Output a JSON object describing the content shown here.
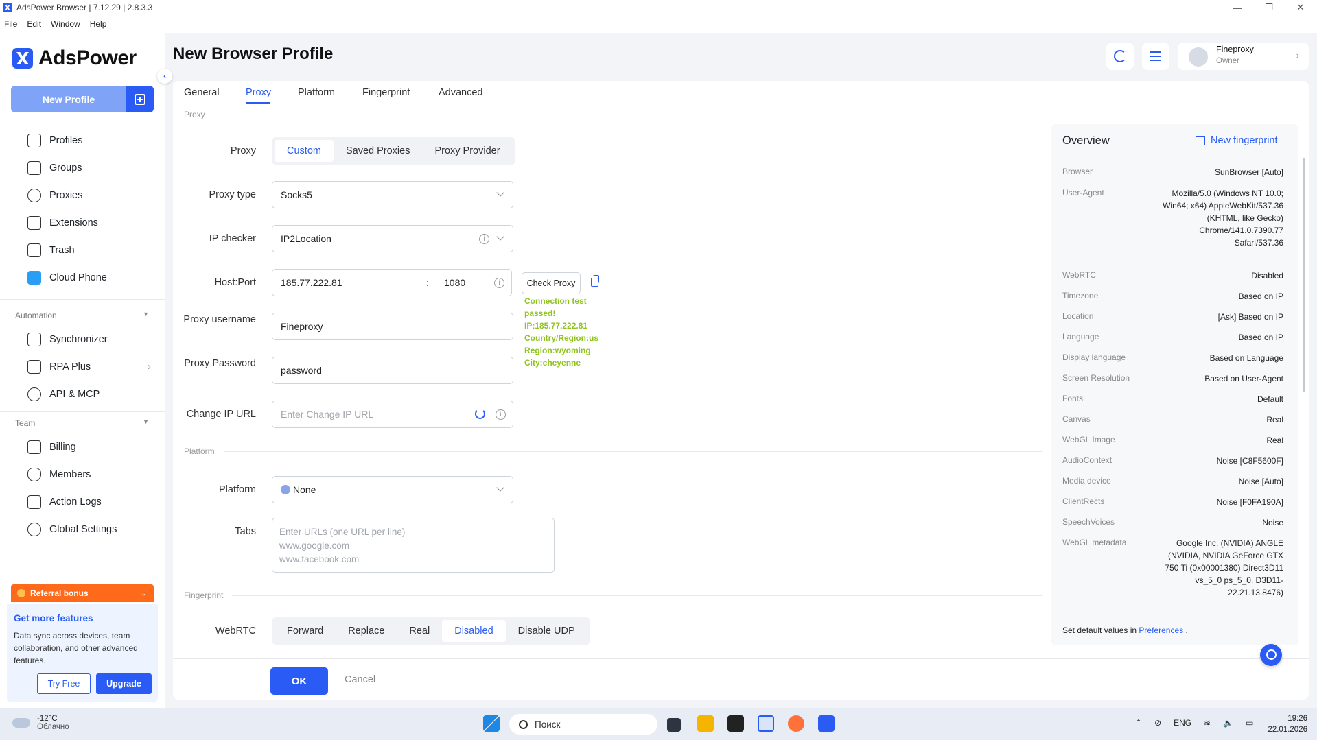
{
  "window": {
    "title": "AdsPower Browser | 7.12.29 | 2.8.3.3",
    "minimize": "—",
    "maximize": "❐",
    "close": "✕"
  },
  "menu": [
    "File",
    "Edit",
    "Window",
    "Help"
  ],
  "sidebar": {
    "brand": "AdsPower",
    "new_profile": "New Profile",
    "items": [
      "Profiles",
      "Groups",
      "Proxies",
      "Extensions",
      "Trash",
      "Cloud Phone"
    ],
    "automation_label": "Automation",
    "automation_items": [
      "Synchronizer",
      "RPA Plus",
      "API & MCP"
    ],
    "team_label": "Team",
    "team_items": [
      "Billing",
      "Members",
      "Action Logs",
      "Global Settings"
    ],
    "referral": "Referral bonus",
    "features_title": "Get more features",
    "features_desc": "Data sync across devices, team collaboration, and other advanced features.",
    "try_free": "Try Free",
    "upgrade": "Upgrade"
  },
  "header": {
    "title": "New Browser Profile",
    "user_name": "Fineproxy",
    "user_role": "Owner"
  },
  "tabs": [
    "General",
    "Proxy",
    "Platform",
    "Fingerprint",
    "Advanced"
  ],
  "proxy": {
    "section": "Proxy",
    "proxy_label": "Proxy",
    "modes": [
      "Custom",
      "Saved Proxies",
      "Proxy Provider"
    ],
    "type_label": "Proxy type",
    "type_value": "Socks5",
    "checker_label": "IP checker",
    "checker_value": "IP2Location",
    "hostport_label": "Host:Port",
    "host": "185.77.222.81",
    "colon": ":",
    "port": "1080",
    "check_button": "Check Proxy",
    "connection": [
      "Connection test passed!",
      "IP:185.77.222.81",
      "Country/Region:us",
      "Region:wyoming",
      "City:cheyenne"
    ],
    "username_label": "Proxy username",
    "username": "Fineproxy",
    "password_label": "Proxy Password",
    "password": "password",
    "change_ip_label": "Change IP URL",
    "change_ip_placeholder": "Enter Change IP URL"
  },
  "platform": {
    "section": "Platform",
    "platform_label": "Platform",
    "platform_value": "None",
    "tabs_label": "Tabs",
    "tabs_placeholder": [
      "Enter URLs (one URL per line)",
      "www.google.com",
      "www.facebook.com"
    ]
  },
  "fingerprint": {
    "section": "Fingerprint",
    "webrtc_label": "WebRTC",
    "webrtc_options": [
      "Forward",
      "Replace",
      "Real",
      "Disabled",
      "Disable UDP"
    ]
  },
  "footer": {
    "ok": "OK",
    "cancel": "Cancel"
  },
  "overview": {
    "title": "Overview",
    "new_fingerprint": "New fingerprint",
    "rows": [
      {
        "k": "Browser",
        "v": "SunBrowser [Auto]"
      },
      {
        "k": "User-Agent",
        "v": "Mozilla/5.0 (Windows NT 10.0; Win64; x64) AppleWebKit/537.36 (KHTML, like Gecko) Chrome/141.0.7390.77 Safari/537.36"
      },
      {
        "k": "WebRTC",
        "v": "Disabled"
      },
      {
        "k": "Timezone",
        "v": "Based on IP"
      },
      {
        "k": "Location",
        "v": "[Ask] Based on IP"
      },
      {
        "k": "Language",
        "v": "Based on IP"
      },
      {
        "k": "Display language",
        "v": "Based on Language"
      },
      {
        "k": "Screen Resolution",
        "v": "Based on User-Agent"
      },
      {
        "k": "Fonts",
        "v": "Default"
      },
      {
        "k": "Canvas",
        "v": "Real"
      },
      {
        "k": "WebGL Image",
        "v": "Real"
      },
      {
        "k": "AudioContext",
        "v": "Noise [C8F5600F]"
      },
      {
        "k": "Media device",
        "v": "Noise [Auto]"
      },
      {
        "k": "ClientRects",
        "v": "Noise [F0FA190A]"
      },
      {
        "k": "SpeechVoices",
        "v": "Noise"
      },
      {
        "k": "WebGL metadata",
        "v": "Google Inc. (NVIDIA) ANGLE (NVIDIA, NVIDIA GeForce GTX 750 Ti (0x00001380) Direct3D11 vs_5_0 ps_5_0, D3D11-22.21.13.8476)"
      }
    ],
    "prefs_prefix": "Set default values in",
    "prefs_link": "Preferences",
    "prefs_suffix": "."
  },
  "taskbar": {
    "temp": "-12°C",
    "weather": "Облачно",
    "search": "Поиск",
    "lang": "ENG",
    "time": "19:26",
    "date": "22.01.2026"
  },
  "colors": {
    "accent": "#2a5cf5",
    "success": "#8fc31f",
    "referral": "#ff6a1a"
  }
}
